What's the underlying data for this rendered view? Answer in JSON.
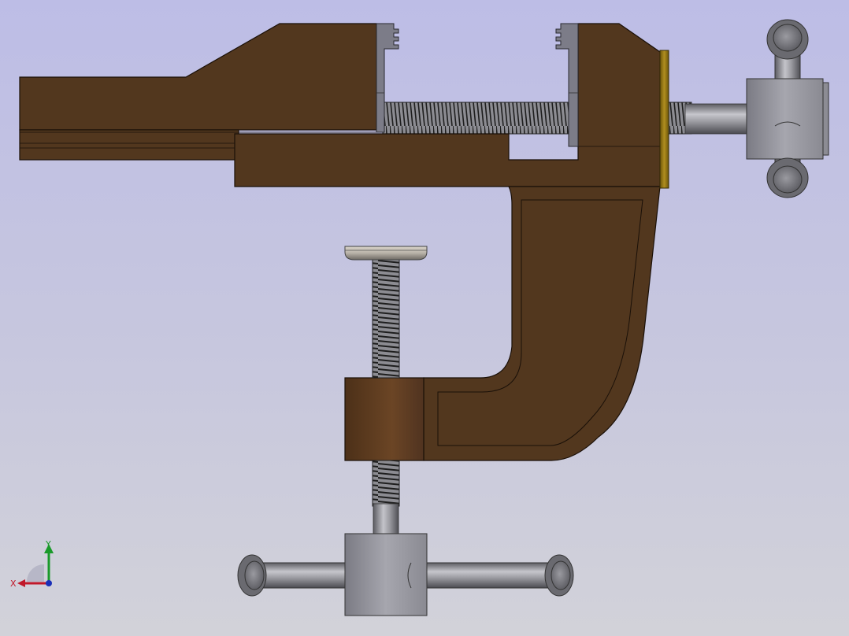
{
  "viewport": {
    "background_top": "#bdbde6",
    "background_bottom": "#d2d2d9"
  },
  "model": {
    "body_color": "#52371e",
    "edge_color": "#1a1008",
    "steel_color": "#8e8e94",
    "thread_color": "#2c2c2c",
    "washer_color": "#8a6d10",
    "parts": [
      "fixed-jaw-body",
      "movable-jaw",
      "lead-screw",
      "vise-handle",
      "c-clamp-frame",
      "clamp-screw",
      "clamp-pad",
      "clamp-handle",
      "thrust-washer"
    ]
  },
  "triad": {
    "x_label": "X",
    "y_label": "Y",
    "x_color": "#c0182a",
    "y_color": "#1a9a2a",
    "z_color": "#1a2fb8"
  }
}
